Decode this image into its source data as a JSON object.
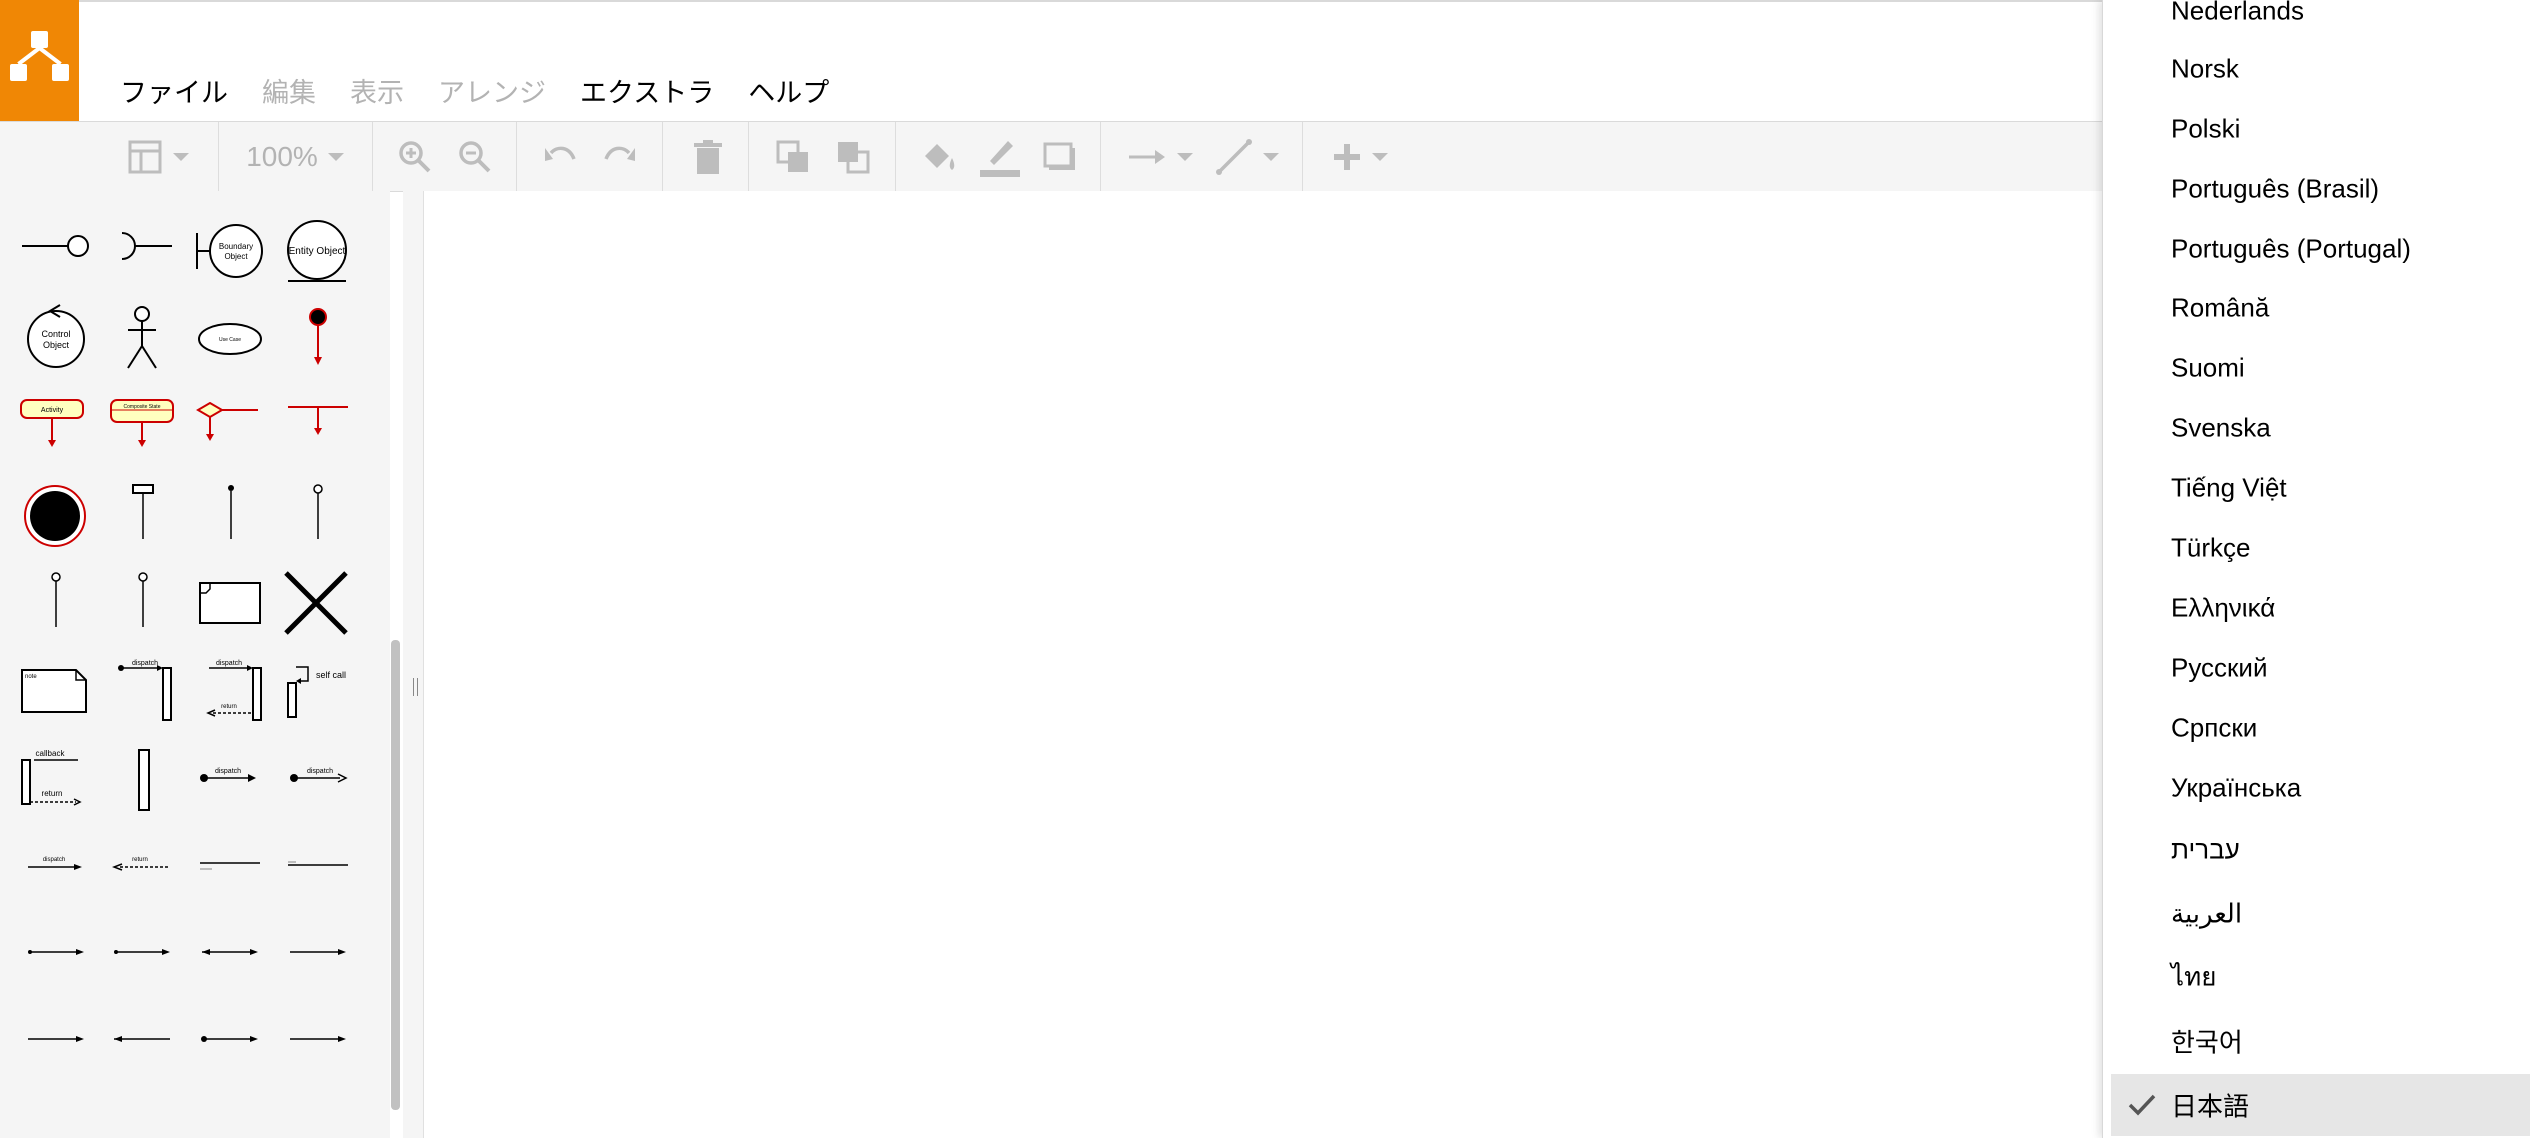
{
  "menubar": {
    "items": [
      {
        "label": "ファイル",
        "enabled": true
      },
      {
        "label": "編集",
        "enabled": false
      },
      {
        "label": "表示",
        "enabled": false
      },
      {
        "label": "アレンジ",
        "enabled": false
      },
      {
        "label": "エクストラ",
        "enabled": true
      },
      {
        "label": "ヘルプ",
        "enabled": true
      }
    ]
  },
  "toolbar": {
    "zoom": "100%",
    "icons": [
      "layout-icon",
      "zoom-in-icon",
      "zoom-out-icon",
      "undo-icon",
      "redo-icon",
      "delete-icon",
      "to-front-icon",
      "to-back-icon",
      "fill-color-icon",
      "line-color-icon",
      "shadow-icon",
      "connection-icon",
      "waypoints-icon",
      "insert-icon"
    ]
  },
  "sidebar": {
    "shape_labels": {
      "boundary": "Boundary Object",
      "entity": "Entity Object",
      "control": "Control Object",
      "usecase": "Use Case",
      "activity": "Activity",
      "composite": "Composite State",
      "note": "note",
      "dispatch": "dispatch",
      "return": "return",
      "self_call": "self call",
      "callback": "callback"
    }
  },
  "language_menu": {
    "items": [
      "Nederlands",
      "Norsk",
      "Polski",
      "Português (Brasil)",
      "Português (Portugal)",
      "Română",
      "Suomi",
      "Svenska",
      "Tiếng Việt",
      "Türkçe",
      "Ελληνικά",
      "Русский",
      "Српски",
      "Українська",
      "עברית",
      "العربية",
      "ไทย",
      "한국어",
      "日本語"
    ],
    "selected": "日本語"
  },
  "colors": {
    "brand": "#f08705",
    "toolbar_bg": "#f5f5f5",
    "uml_red": "#cc0000",
    "uml_fill": "#ffffc0"
  }
}
